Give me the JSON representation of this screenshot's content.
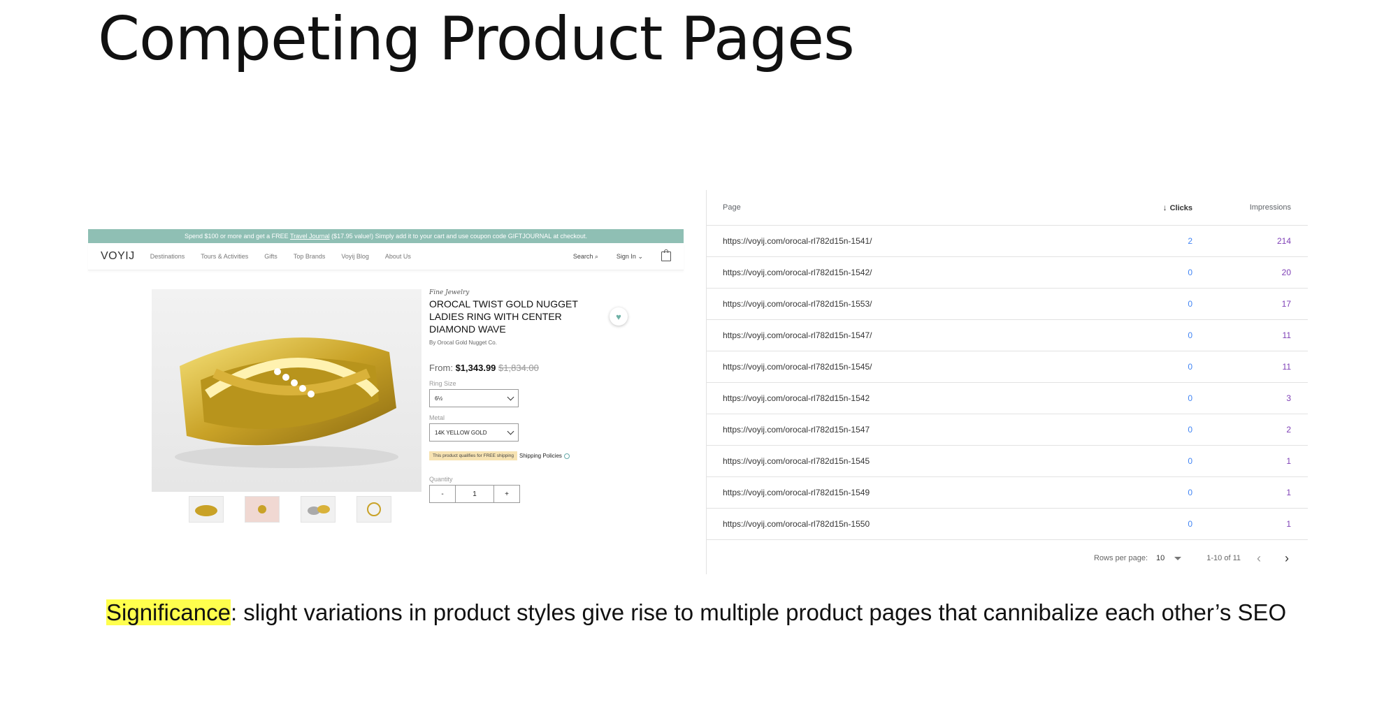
{
  "slide": {
    "title": "Competing Product Pages",
    "significance_label": "Significance",
    "significance_text": ": slight variations in product styles give rise to multiple product pages that cannibalize each other’s SEO"
  },
  "product_page": {
    "promo_text_before": "Spend $100 or more and get a FREE ",
    "promo_link": "Travel Journal",
    "promo_text_after": " ($17.95 value!) Simply add it to your cart and use coupon code GIFTJOURNAL at checkout.",
    "logo": "VOYIJ",
    "nav_items": [
      "Destinations",
      "Tours & Activities",
      "Gifts",
      "Top Brands",
      "Voyij Blog",
      "About Us"
    ],
    "search_label": "Search",
    "signin_label": "Sign In",
    "category": "Fine Jewelry",
    "product_name": "Orocal Twist Gold Nugget Ladies Ring with Center Diamond Wave",
    "brand": "By Orocal Gold Nugget Co.",
    "price_from": "From:",
    "price_sale": "$1,343.99",
    "price_original": "$1,834.00",
    "ring_size_label": "Ring Size",
    "ring_size_value": "6½",
    "metal_label": "Metal",
    "metal_value": "14K YELLOW GOLD",
    "shipping_badge": "This product qualifies for FREE shipping",
    "shipping_policies": "Shipping Policies",
    "quantity_label": "Quantity",
    "qty_minus": "-",
    "qty_value": "1",
    "qty_plus": "+"
  },
  "table": {
    "headers": {
      "page": "Page",
      "clicks": "Clicks",
      "impressions": "Impressions"
    },
    "rows": [
      {
        "page": "https://voyij.com/orocal-rl782d15n-1541/",
        "clicks": "2",
        "impressions": "214"
      },
      {
        "page": "https://voyij.com/orocal-rl782d15n-1542/",
        "clicks": "0",
        "impressions": "20"
      },
      {
        "page": "https://voyij.com/orocal-rl782d15n-1553/",
        "clicks": "0",
        "impressions": "17"
      },
      {
        "page": "https://voyij.com/orocal-rl782d15n-1547/",
        "clicks": "0",
        "impressions": "11"
      },
      {
        "page": "https://voyij.com/orocal-rl782d15n-1545/",
        "clicks": "0",
        "impressions": "11"
      },
      {
        "page": "https://voyij.com/orocal-rl782d15n-1542",
        "clicks": "0",
        "impressions": "3"
      },
      {
        "page": "https://voyij.com/orocal-rl782d15n-1547",
        "clicks": "0",
        "impressions": "2"
      },
      {
        "page": "https://voyij.com/orocal-rl782d15n-1545",
        "clicks": "0",
        "impressions": "1"
      },
      {
        "page": "https://voyij.com/orocal-rl782d15n-1549",
        "clicks": "0",
        "impressions": "1"
      },
      {
        "page": "https://voyij.com/orocal-rl782d15n-1550",
        "clicks": "0",
        "impressions": "1"
      }
    ],
    "rows_per_page_label": "Rows per page:",
    "rows_per_page_value": "10",
    "range_text": "1-10 of 11"
  },
  "colors": {
    "clicks": "#4285f4",
    "impressions": "#7e3fb6",
    "promo_bar": "#8fbfb4",
    "highlight": "#ffff4d"
  }
}
